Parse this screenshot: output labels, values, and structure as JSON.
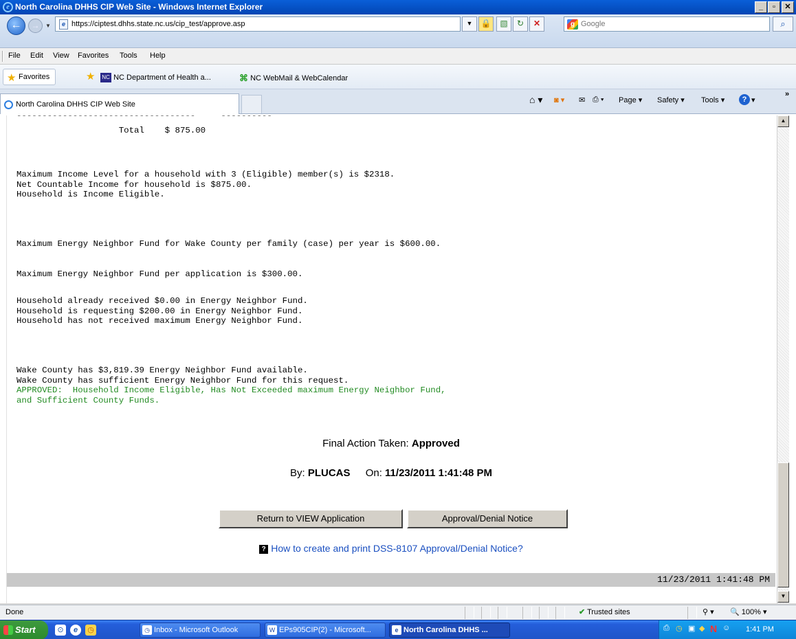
{
  "window": {
    "title": "North Carolina DHHS CIP Web Site - Windows Internet Explorer"
  },
  "nav": {
    "url": "https://ciptest.dhhs.state.nc.us/cip_test/approve.asp",
    "search_placeholder": "Google"
  },
  "menu": [
    "File",
    "Edit",
    "View",
    "Favorites",
    "Tools",
    "Help"
  ],
  "favorites": {
    "label": "Favorites",
    "links": [
      "NC Department of Health a...",
      "NC WebMail & WebCalendar"
    ]
  },
  "tab": {
    "label": "North Carolina DHHS CIP Web Site"
  },
  "commands": {
    "page": "Page",
    "safety": "Safety",
    "tools": "Tools"
  },
  "content": {
    "separator_line": "-----------------------------------     ----------",
    "total_line": "                    Total    $ 875.00",
    "income_lines": "Maximum Income Level for a household with 3 (Eligible) member(s) is $2318.\nNet Countable Income for household is $875.00.\nHousehold is Income Eligible.",
    "energy_max_family": "Maximum Energy Neighbor Fund for Wake County per family (case) per year is $600.00.",
    "energy_max_app": "Maximum Energy Neighbor Fund per application is $300.00.",
    "household_lines": "Household already received $0.00 in Energy Neighbor Fund.\nHousehold is requesting $200.00 in Energy Neighbor Fund.\nHousehold has not received maximum Energy Neighbor Fund.",
    "county_lines": "Wake County has $3,819.39 Energy Neighbor Fund available.\nWake County has sufficient Energy Neighbor Fund for this request.",
    "approved_lines": "APPROVED:  Household Income Eligible, Has Not Exceeded maximum Energy Neighbor Fund,\nand Sufficient County Funds.",
    "final_action_label": "Final Action Taken:",
    "final_action_value": "Approved",
    "by_label": "By:",
    "by_value": "PLUCAS",
    "on_label": "On:",
    "on_value": "11/23/2011 1:41:48 PM",
    "return_button": "Return to VIEW Application",
    "notice_button": "Approval/Denial Notice",
    "help_link": "How to create and print DSS-8107 Approval/Denial Notice?",
    "footer_timestamp": "11/23/2011 1:41:48 PM"
  },
  "status": {
    "text": "Done",
    "zone": "Trusted sites",
    "zoom": "100%"
  },
  "taskbar": {
    "start": "Start",
    "items": [
      "Inbox - Microsoft Outlook",
      "EPs905CIP(2) - Microsoft...",
      "North Carolina DHHS ..."
    ],
    "clock": "1:41 PM"
  },
  "colors": {
    "approved_text": "#228b22",
    "link": "#1a4fc0",
    "title_bar": "#0a5fd8"
  }
}
